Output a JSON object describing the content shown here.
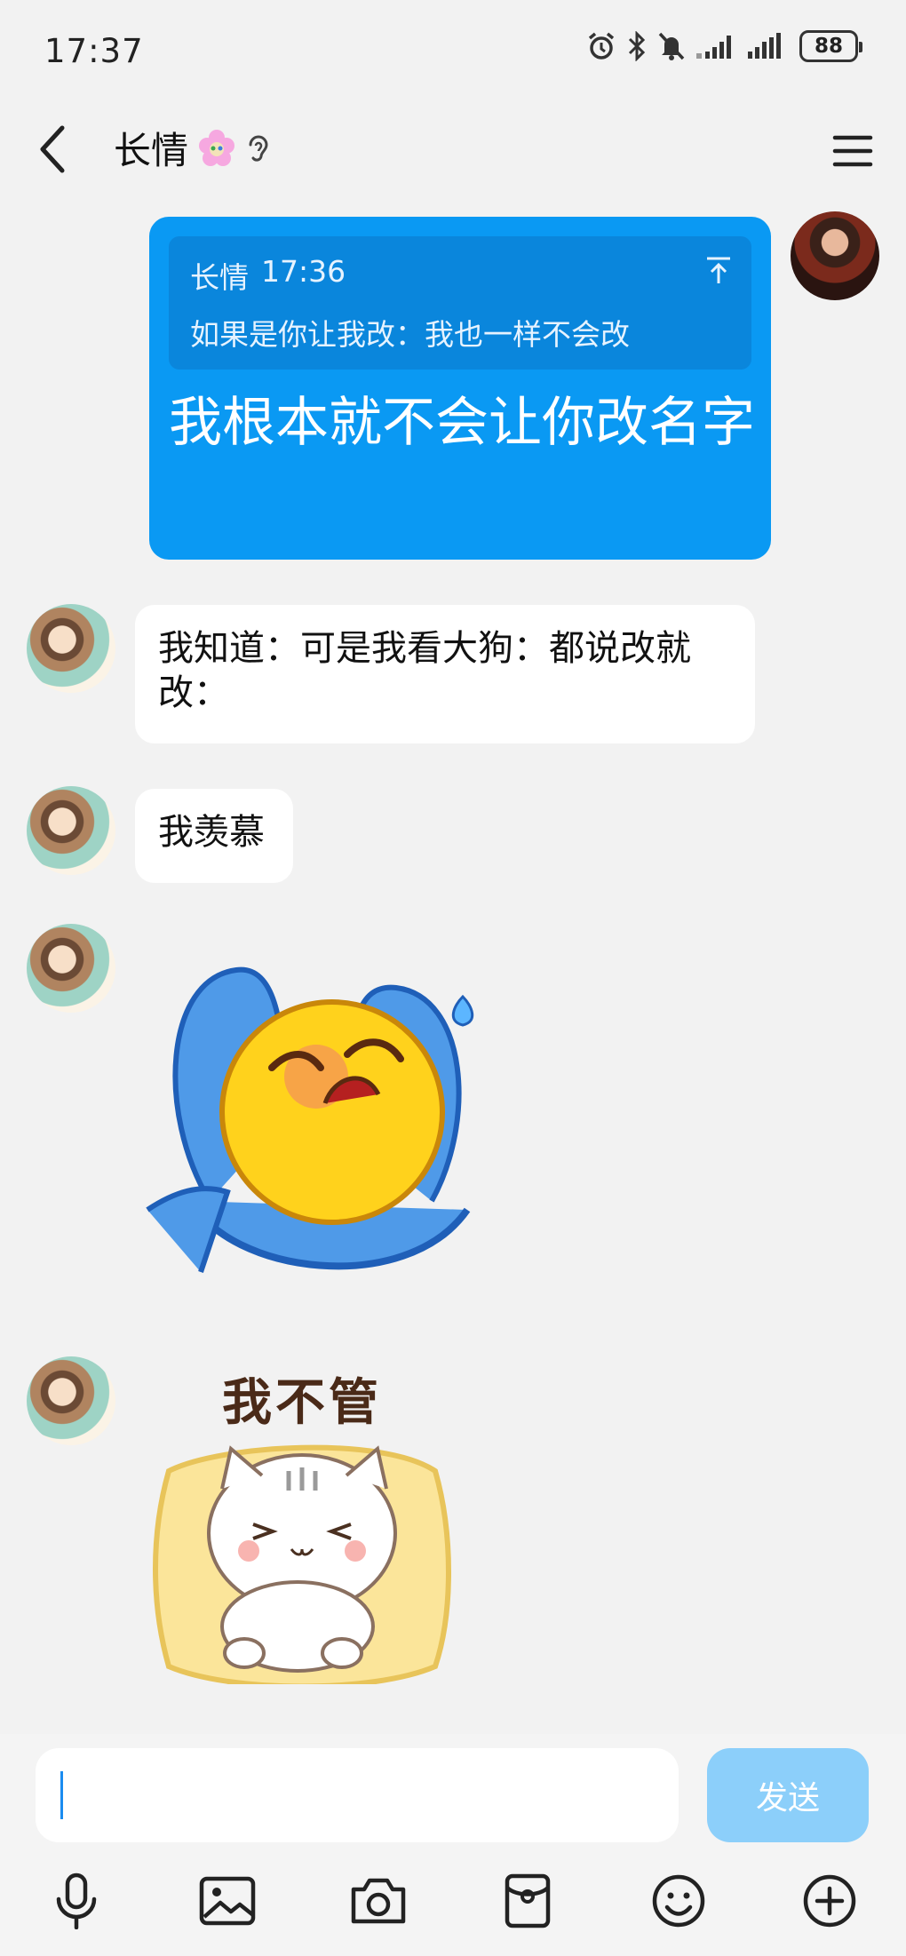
{
  "status_bar": {
    "time": "17:37",
    "battery": "88"
  },
  "header": {
    "title": "长情"
  },
  "messages": {
    "sent": {
      "quote_author": "长情",
      "quote_time": "17:36",
      "quote_text": "如果是你让我改：我也一样不会改",
      "text": "我根本就不会让你改名字"
    },
    "received": [
      {
        "text": "我知道：可是我看大狗：都说改就改："
      },
      {
        "text": "我羡慕"
      }
    ],
    "sticker_cat_caption": "我不管"
  },
  "input": {
    "value": "",
    "send_label": "发送"
  },
  "colors": {
    "sent_bubble": "#0a99f3",
    "quote_bg": "#0a86dc",
    "send_button_disabled": "#8ccffa",
    "page_bg": "#f2f2f2"
  },
  "toolbar_icons": [
    "mic-icon",
    "image-icon",
    "camera-icon",
    "red-packet-icon",
    "emoji-icon",
    "plus-icon"
  ]
}
